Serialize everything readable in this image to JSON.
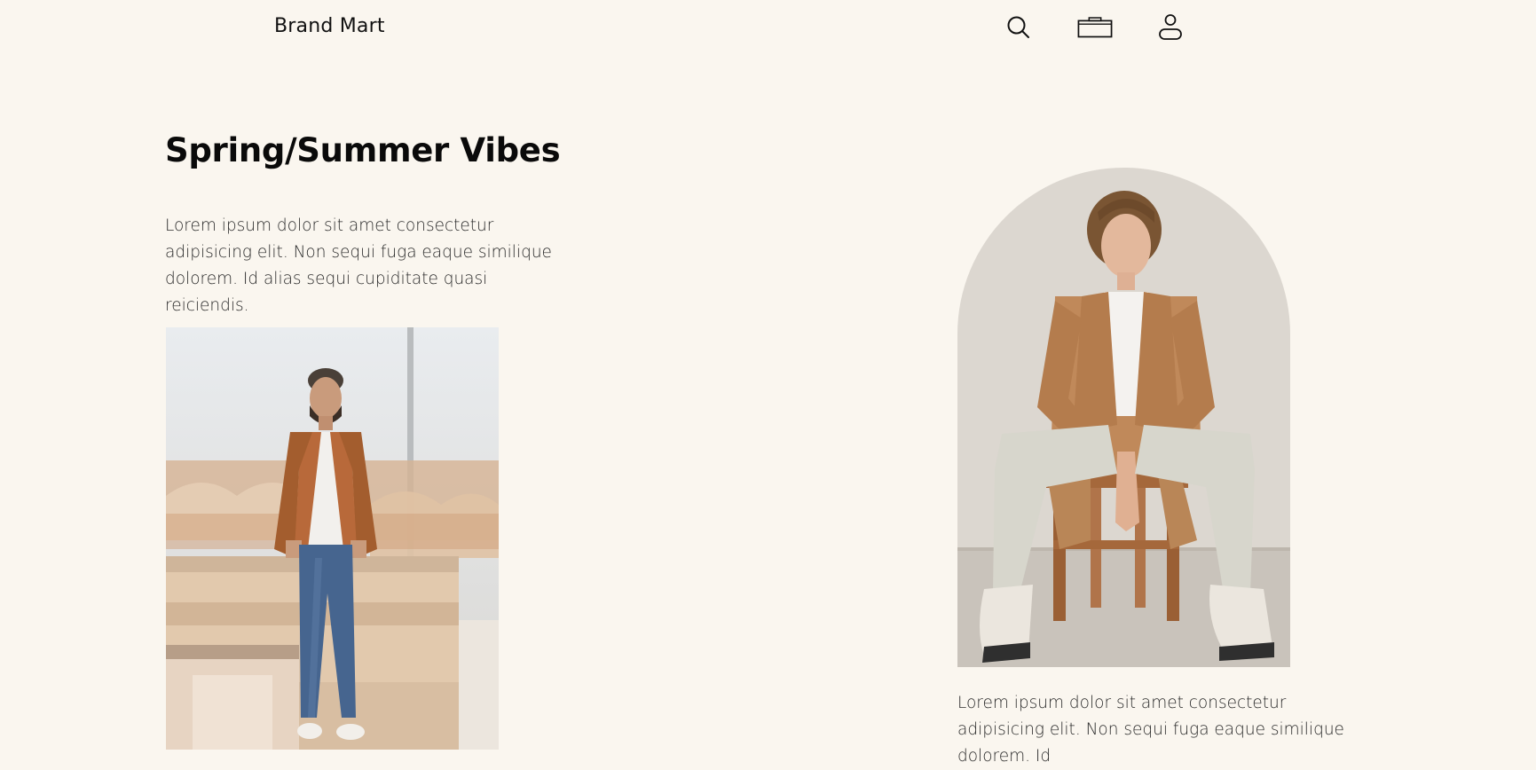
{
  "header": {
    "brand": "Brand Mart",
    "icons": [
      "search-icon",
      "bag-icon",
      "user-icon"
    ]
  },
  "hero": {
    "title": "Spring/Summer Vibes",
    "intro": "Lorem ipsum dolor sit amet consectetur adipisicing elit. Non sequi fuga eaque similique dolorem. Id alias sequi cupiditate quasi reiciendis."
  },
  "feature": {
    "caption": "Lorem ipsum dolor sit amet consectetur adipisicing elit. Non sequi fuga eaque similique dolorem. Id"
  },
  "colors": {
    "background": "#faf6ef",
    "text": "#111111"
  }
}
